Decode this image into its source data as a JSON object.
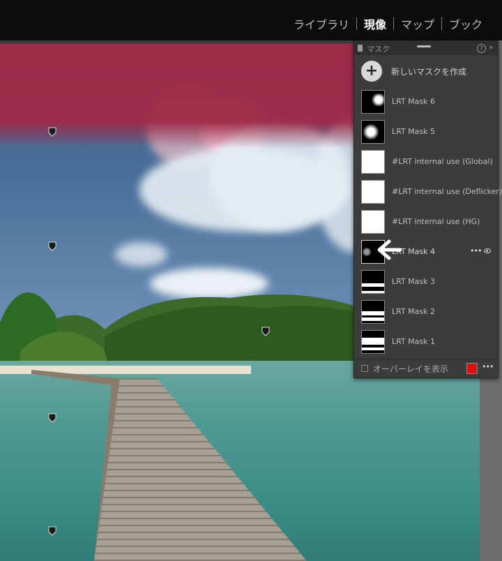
{
  "modules": {
    "items": [
      {
        "label": "ライブラリ",
        "active": false
      },
      {
        "label": "現像",
        "active": true
      },
      {
        "label": "マップ",
        "active": false
      },
      {
        "label": "ブック",
        "active": false
      }
    ]
  },
  "mask_panel": {
    "title": "マスク",
    "help_icon": "?",
    "collapse_icon": "»",
    "create_label": "新しいマスクを作成",
    "masks": [
      {
        "label": "LRT Mask 6",
        "thumb": "spot-upper-right"
      },
      {
        "label": "LRT Mask 5",
        "thumb": "spot-center"
      },
      {
        "label": "#LRT internal use (Global)",
        "thumb": "white"
      },
      {
        "label": "#LRT internal use (Deflicker)",
        "thumb": "white"
      },
      {
        "label": "#LRT internal use (HG)",
        "thumb": "white"
      },
      {
        "label": "LRT Mask 4",
        "thumb": "black",
        "selected": true
      },
      {
        "label": "LRT Mask 3",
        "thumb": "band-bottom"
      },
      {
        "label": "LRT Mask 2",
        "thumb": "band-lower"
      },
      {
        "label": "LRT Mask 1",
        "thumb": "band-middle"
      }
    ],
    "overlay_label": "オーバーレイを表示",
    "overlay_color": "#e01010"
  }
}
